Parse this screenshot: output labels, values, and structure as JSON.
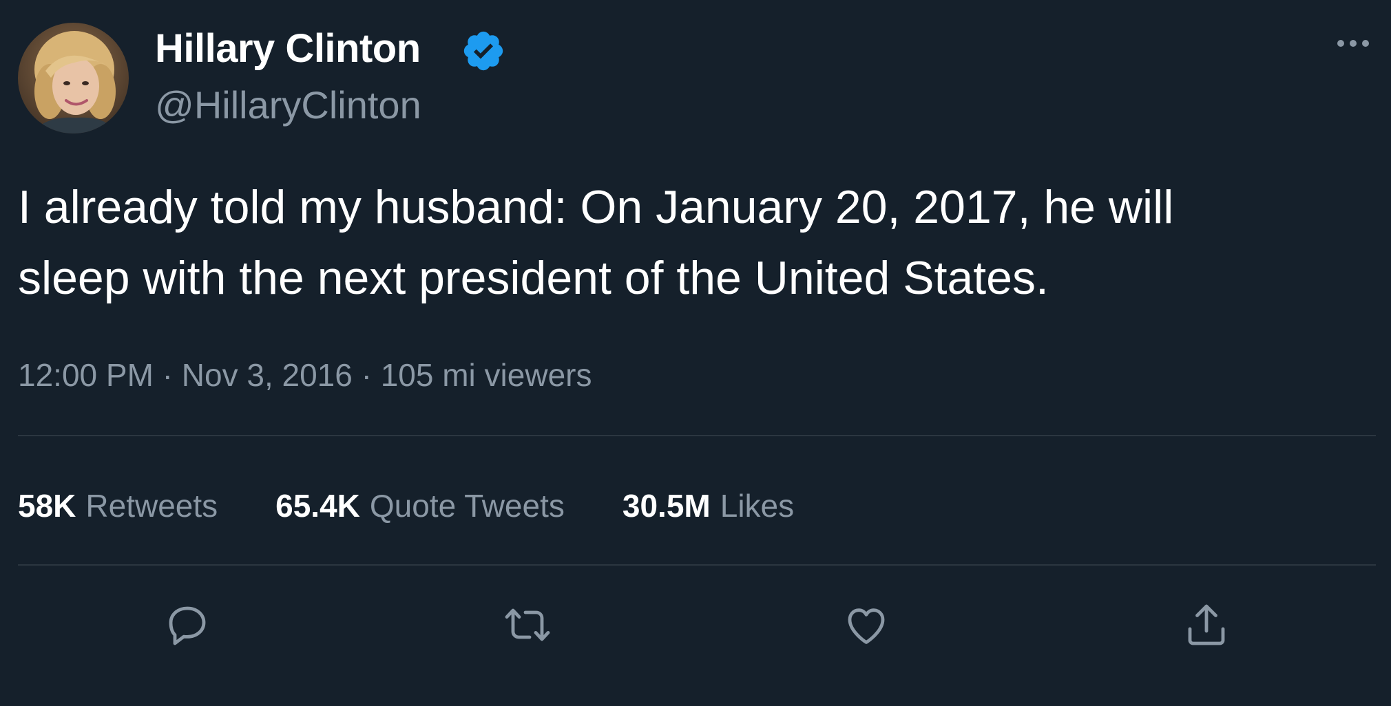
{
  "tweet": {
    "author": {
      "name": "Hillary Clinton",
      "handle": "@HillaryClinton",
      "verified": true,
      "avatar": "profile-photo"
    },
    "text": "I already told my husband: On January 20, 2017, he will\nsleep with the next president of the United States.",
    "meta": "12:00 PM · Nov 3, 2016 · 105 mi viewers",
    "stats": [
      {
        "count": "58K",
        "label": "Retweets"
      },
      {
        "count": "65.4K",
        "label": "Quote Tweets"
      },
      {
        "count": "30.5M",
        "label": "Likes"
      }
    ],
    "actions": [
      {
        "name": "reply",
        "icon": "speech-bubble-icon"
      },
      {
        "name": "retweet",
        "icon": "retweet-arrows-icon"
      },
      {
        "name": "like",
        "icon": "heart-icon"
      },
      {
        "name": "share",
        "icon": "share-upload-icon"
      }
    ]
  },
  "colors": {
    "background": "#15202b",
    "text_primary": "#ffffff",
    "text_secondary": "#8b98a5",
    "verified_blue": "#1d9bf0",
    "divider": "#2b3640"
  }
}
